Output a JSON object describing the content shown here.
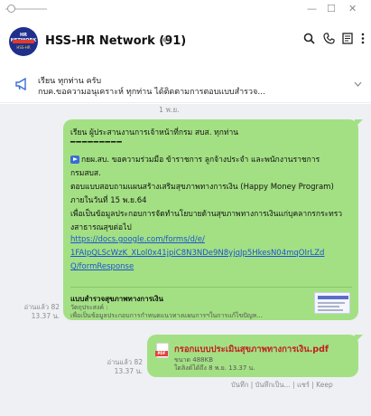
{
  "window": {
    "minimize": "—",
    "maximize": "☐",
    "close": "✕"
  },
  "avatar": {
    "line1": "HR NETWORK",
    "line2": "HSS-HR"
  },
  "header": {
    "title": "HSS-HR Network (91)"
  },
  "announcement": {
    "line1": "เรียน ทุกท่าน ครับ",
    "line2": "กบค.ขอความอนุเคราะห์ ทุกท่าน ได้ติดตามการตอบแบบสำรวจ..."
  },
  "date_chip": "1 พ.ย.",
  "message1": {
    "greeting": "เรียน ผู้ประสานงานการเจ้าหน้าที่กรม สบส. ทุกท่าน",
    "dashes": "━━━━━━━━━",
    "line1": "กยผ.สบ. ขอความร่วมมือ ข้าราชการ ลูกจ้างประจำ และพนักงานราชการ",
    "line2": "กรมสบส.",
    "line3": "ตอบแบบสอบถามแผนสร้างเสริมสุขภาพทางการเงิน (Happy Money Program)",
    "line4": "ภายในวันที่ 15 พ.ย.64",
    "line5": "เพื่อเป็นข้อมูลประกอบการจัดทำนโยบายด้านสุขภาพทางการเงินแก่บุคลากรกระทรว",
    "line6": "งสาธารณสุขต่อไป",
    "link1": "https://docs.google.com/forms/d/e/",
    "link2": "1FAIpQLScWzK_XLol0x41jpiC8N3NDe9N8yjqJp5HkesN04mqOIrLZd",
    "link3": "Q/formResponse",
    "preview_title": "แบบสำรวจสุขภาพทางการเงิน",
    "preview_subtitle": "วัตถุประสงค์ :",
    "preview_desc": "เพื่อเป็นข้อมูลประกอบการกำหนดแนวทางแผนการฯในการแก้ไขปัญห...",
    "read_label": "อ่านแล้ว 82",
    "time": "13.37 น."
  },
  "message2": {
    "file_name": "กรอกแบบประเมินสุขภาพทางการเงิน.pdf",
    "file_size": "ขนาด 488KB",
    "expiry": "ใดลิงต์ได้ถึง 8 พ.ย. 13.37 น.",
    "read_label": "อ่านแล้ว 82",
    "time": "13.37 น."
  },
  "actions": "บันทึก | บันทึกเป็น... | แชร์ | Keep"
}
